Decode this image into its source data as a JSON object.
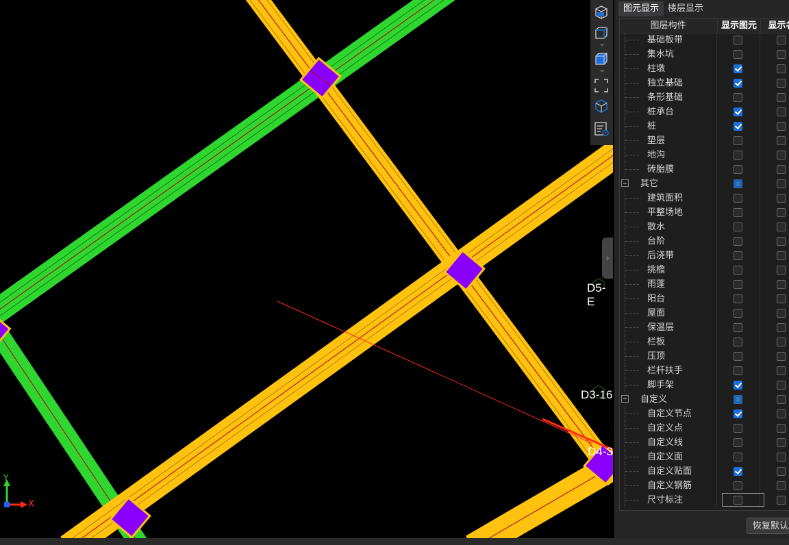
{
  "canvas": {
    "axis_labels": [
      "D5-E",
      "D3-16",
      "D4-3"
    ],
    "axis_y_label": "Y",
    "axis_x_label": "X"
  },
  "toolbar": {
    "tools": [
      "3d-view-icon",
      "cube-view-icon",
      "cube-solid-icon",
      "fit-frame-icon",
      "layer-display-icon",
      "properties-icon"
    ]
  },
  "panel": {
    "tabs": [
      {
        "label": "图元显示",
        "active": true
      },
      {
        "label": "楼层显示",
        "active": false
      }
    ],
    "header": {
      "component": "图层构件",
      "show_element": "显示图元",
      "show_name": "显示名"
    },
    "rows": [
      {
        "label": "基础板带",
        "group": false,
        "show": false,
        "name": false
      },
      {
        "label": "集水坑",
        "group": false,
        "show": false,
        "name": false
      },
      {
        "label": "柱墩",
        "group": false,
        "show": true,
        "name": false
      },
      {
        "label": "独立基础",
        "group": false,
        "show": true,
        "name": false
      },
      {
        "label": "条形基础",
        "group": false,
        "show": false,
        "name": false
      },
      {
        "label": "桩承台",
        "group": false,
        "show": true,
        "name": false
      },
      {
        "label": "桩",
        "group": false,
        "show": true,
        "name": false
      },
      {
        "label": "垫层",
        "group": false,
        "show": false,
        "name": false
      },
      {
        "label": "地沟",
        "group": false,
        "show": false,
        "name": false
      },
      {
        "label": "砖胎膜",
        "group": false,
        "show": false,
        "name": false
      },
      {
        "label": "其它",
        "group": true,
        "show": "partial",
        "name": false
      },
      {
        "label": "建筑面积",
        "group": false,
        "show": false,
        "name": false
      },
      {
        "label": "平整场地",
        "group": false,
        "show": false,
        "name": false
      },
      {
        "label": "散水",
        "group": false,
        "show": false,
        "name": false
      },
      {
        "label": "台阶",
        "group": false,
        "show": false,
        "name": false
      },
      {
        "label": "后浇带",
        "group": false,
        "show": false,
        "name": false
      },
      {
        "label": "挑檐",
        "group": false,
        "show": false,
        "name": false
      },
      {
        "label": "雨蓬",
        "group": false,
        "show": false,
        "name": false
      },
      {
        "label": "阳台",
        "group": false,
        "show": false,
        "name": false
      },
      {
        "label": "屋面",
        "group": false,
        "show": false,
        "name": false
      },
      {
        "label": "保温层",
        "group": false,
        "show": false,
        "name": false
      },
      {
        "label": "栏板",
        "group": false,
        "show": false,
        "name": false
      },
      {
        "label": "压顶",
        "group": false,
        "show": false,
        "name": false
      },
      {
        "label": "栏杆扶手",
        "group": false,
        "show": false,
        "name": false
      },
      {
        "label": "脚手架",
        "group": false,
        "show": true,
        "name": false
      },
      {
        "label": "自定义",
        "group": true,
        "show": "partial",
        "name": false
      },
      {
        "label": "自定义节点",
        "group": false,
        "show": true,
        "name": false
      },
      {
        "label": "自定义点",
        "group": false,
        "show": false,
        "name": false
      },
      {
        "label": "自定义线",
        "group": false,
        "show": false,
        "name": false
      },
      {
        "label": "自定义面",
        "group": false,
        "show": false,
        "name": false
      },
      {
        "label": "自定义贴面",
        "group": false,
        "show": true,
        "name": false
      },
      {
        "label": "自定义钢筋",
        "group": false,
        "show": false,
        "name": false
      },
      {
        "label": "尺寸标注",
        "group": false,
        "show": false,
        "name": false
      }
    ],
    "restore_button": "恢复默认设"
  },
  "colors": {
    "beam_yellow": "#ffc20e",
    "beam_green": "#2fd62f",
    "column_purple": "#8a00ff",
    "accent_blue": "#1e6fd9",
    "annotation_red": "#ff2a1a"
  }
}
